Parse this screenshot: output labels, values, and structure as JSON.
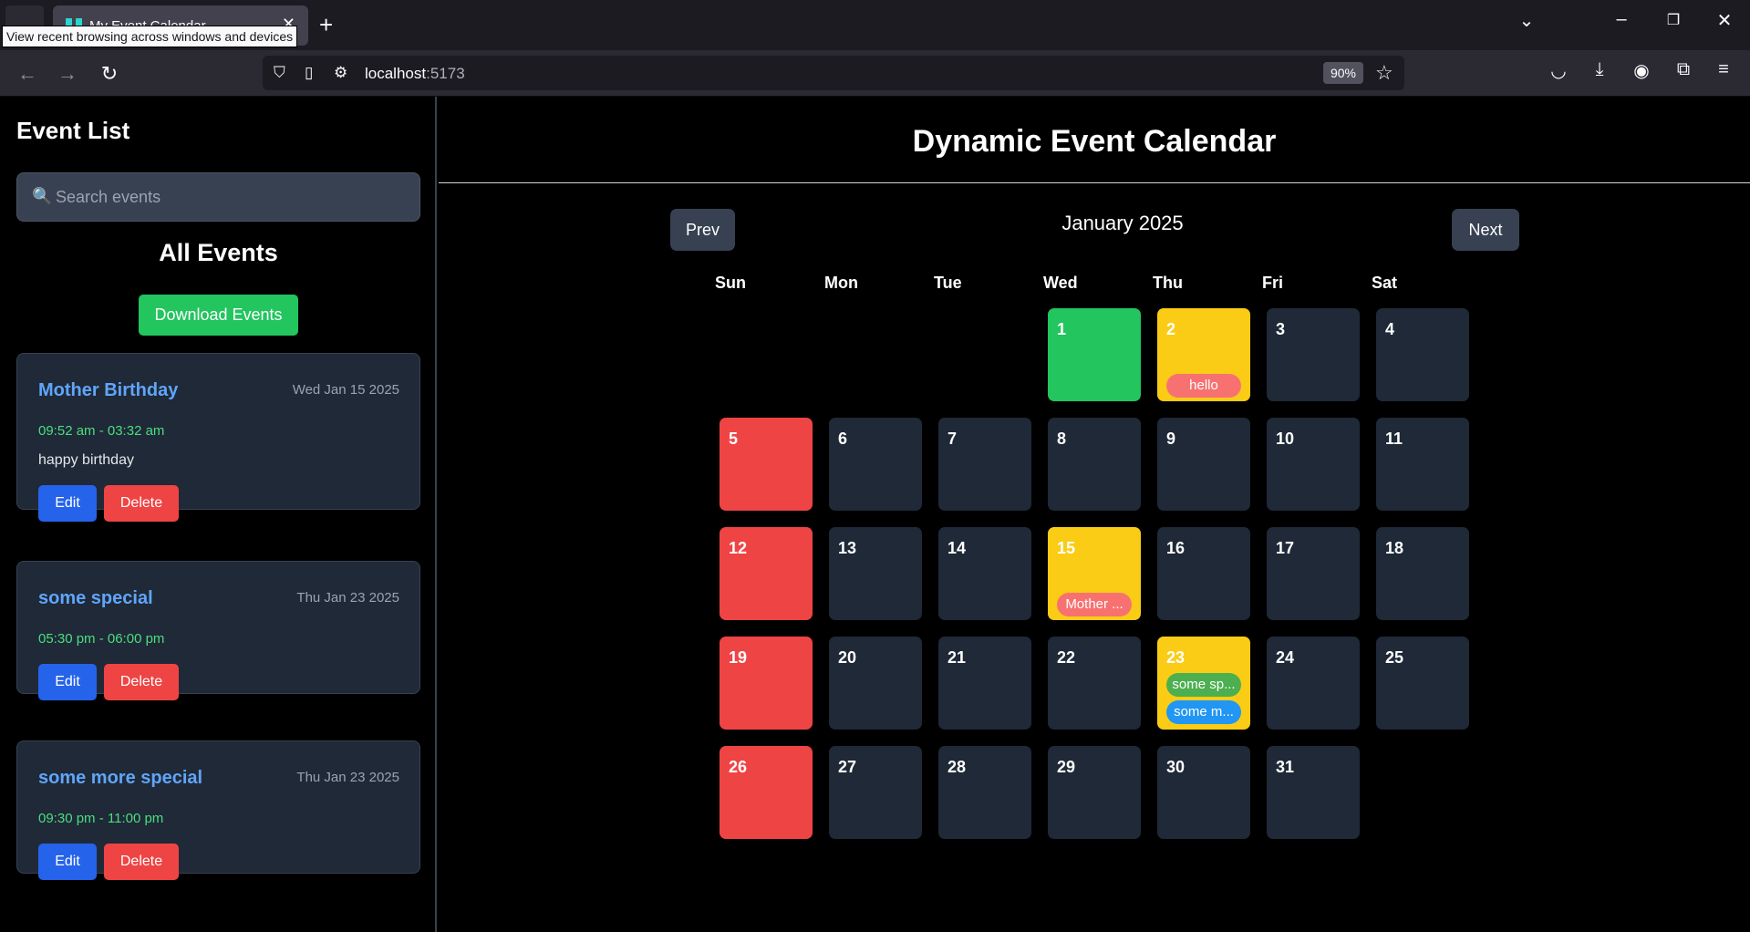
{
  "browser": {
    "tab_title": "My Event Calendar",
    "tooltip": "View recent browsing across windows and devices",
    "url_host": "localhost",
    "url_port": ":5173",
    "zoom": "90%"
  },
  "sidebar": {
    "title": "Event List",
    "search_placeholder": "Search events",
    "all_events_title": "All Events",
    "download_label": "Download Events",
    "edit_label": "Edit",
    "delete_label": "Delete",
    "events": [
      {
        "title": "Mother Birthday",
        "date": "Wed Jan 15 2025",
        "time": "09:52 am - 03:32 am",
        "description": "happy birthday"
      },
      {
        "title": "some special",
        "date": "Thu Jan 23 2025",
        "time": "05:30 pm - 06:00 pm",
        "description": ""
      },
      {
        "title": "some more special",
        "date": "Thu Jan 23 2025",
        "time": "09:30 pm - 11:00 pm",
        "description": ""
      }
    ]
  },
  "calendar": {
    "title": "Dynamic Event Calendar",
    "prev_label": "Prev",
    "next_label": "Next",
    "month_label": "January 2025",
    "weekdays": [
      "Sun",
      "Mon",
      "Tue",
      "Wed",
      "Thu",
      "Fri",
      "Sat"
    ],
    "days": {
      "d1": "1",
      "d2": "2",
      "d3": "3",
      "d4": "4",
      "d5": "5",
      "d6": "6",
      "d7": "7",
      "d8": "8",
      "d9": "9",
      "d10": "10",
      "d11": "11",
      "d12": "12",
      "d13": "13",
      "d14": "14",
      "d15": "15",
      "d16": "16",
      "d17": "17",
      "d18": "18",
      "d19": "19",
      "d20": "20",
      "d21": "21",
      "d22": "22",
      "d23": "23",
      "d24": "24",
      "d25": "25",
      "d26": "26",
      "d27": "27",
      "d28": "28",
      "d29": "29",
      "d30": "30",
      "d31": "31"
    },
    "pills": {
      "d2": "hello",
      "d15": "Mother ...",
      "d23a": "some sp...",
      "d23b": "some m..."
    },
    "colors": {
      "today": "#22c55e",
      "event_day": "#facc15",
      "sunday": "#ef4444",
      "default_day": "#1f2937"
    }
  }
}
